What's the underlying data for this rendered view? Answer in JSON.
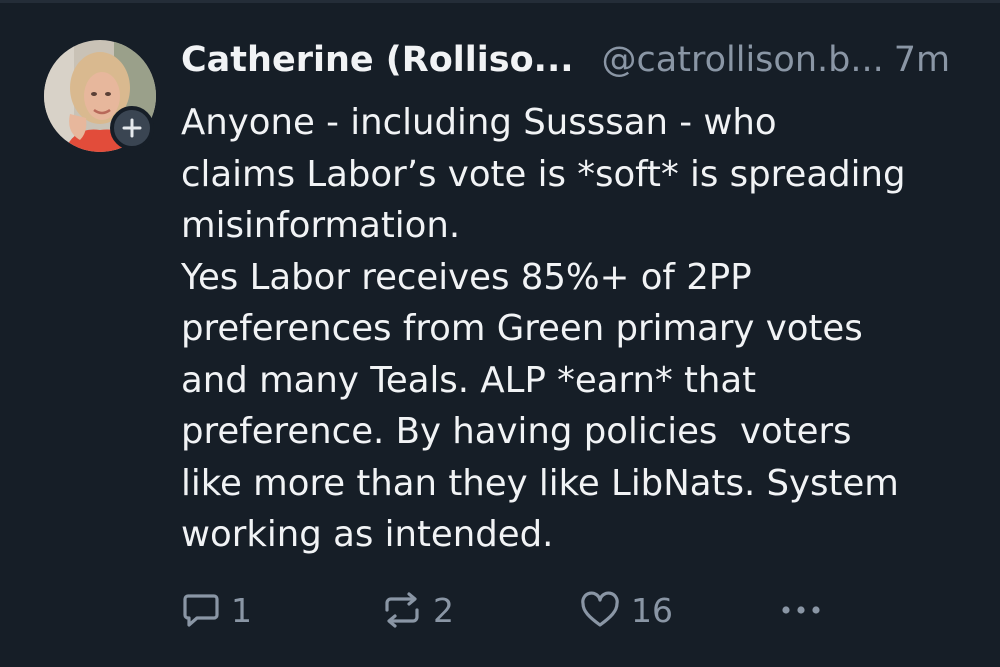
{
  "post": {
    "author": {
      "display_name": "Catherine (Rolliso...",
      "handle": "@catrollison.b...",
      "avatar_icon": "avatar-photo",
      "follow_icon": "plus-icon"
    },
    "time_ago": "7m",
    "text": "Anyone - including Susssan - who\nclaims Labor’s vote is *soft* is spreading\nmisinformation.\nYes Labor receives 85%+ of 2PP\npreferences from Green primary votes\nand many Teals. ALP *earn* that\npreference. By having policies  voters\nlike more than they like LibNats. System\nworking as intended.",
    "actions": {
      "reply_count": "1",
      "repost_count": "2",
      "like_count": "16",
      "reply_icon": "reply-icon",
      "repost_icon": "repost-icon",
      "like_icon": "heart-icon",
      "more_icon": "more-options-icon"
    }
  },
  "colors": {
    "background": "#161e27",
    "text": "#f1f3f5",
    "muted": "#8a96a5",
    "follow_button": "#3a4552"
  }
}
